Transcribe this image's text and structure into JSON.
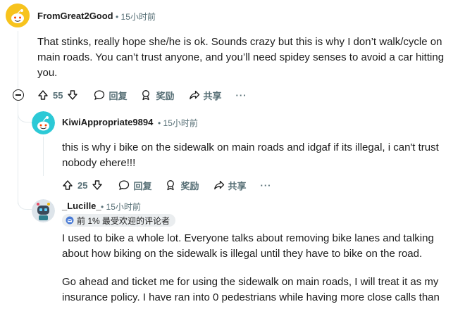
{
  "comments": [
    {
      "author": "FromGreat2Good",
      "time": "15小时前",
      "body": "That stinks, really hope she/he is ok. Sounds crazy but this is why I don’t walk/cycle on main roads. You can’t trust anyone, and you’ll need spidey senses to avoid a car hitting you.",
      "votes": "55",
      "reply_label": "回复",
      "award_label": "奖励",
      "share_label": "共享",
      "more": "···"
    },
    {
      "author": "KiwiAppropriate9894",
      "time": "15小时前",
      "body": "this is why i bike on the sidewalk on main roads and idgaf if its illegal, i can't trust nobody ehere!!!",
      "votes": "25",
      "reply_label": "回复",
      "award_label": "奖励",
      "share_label": "共享",
      "more": "···"
    },
    {
      "author": "_Lucille_",
      "time": "15小时前",
      "flair": "前 1% 最受欢迎的评论者",
      "body_p1": "I used to bike a whole lot. Everyone talks about removing bike lanes and talking about how biking on the sidewalk is illegal until they have to bike on the road.",
      "body_p2": "Go ahead and ticket me for using the sidewalk on main roads, I will treat it as my insurance policy. I have ran into 0 pedestrians while having more close calls than"
    }
  ],
  "separator": "•",
  "colors": {
    "text": "#1c1c1c",
    "meta": "#576f76",
    "line": "#e5ebee",
    "flair_bg": "#eaedef"
  }
}
